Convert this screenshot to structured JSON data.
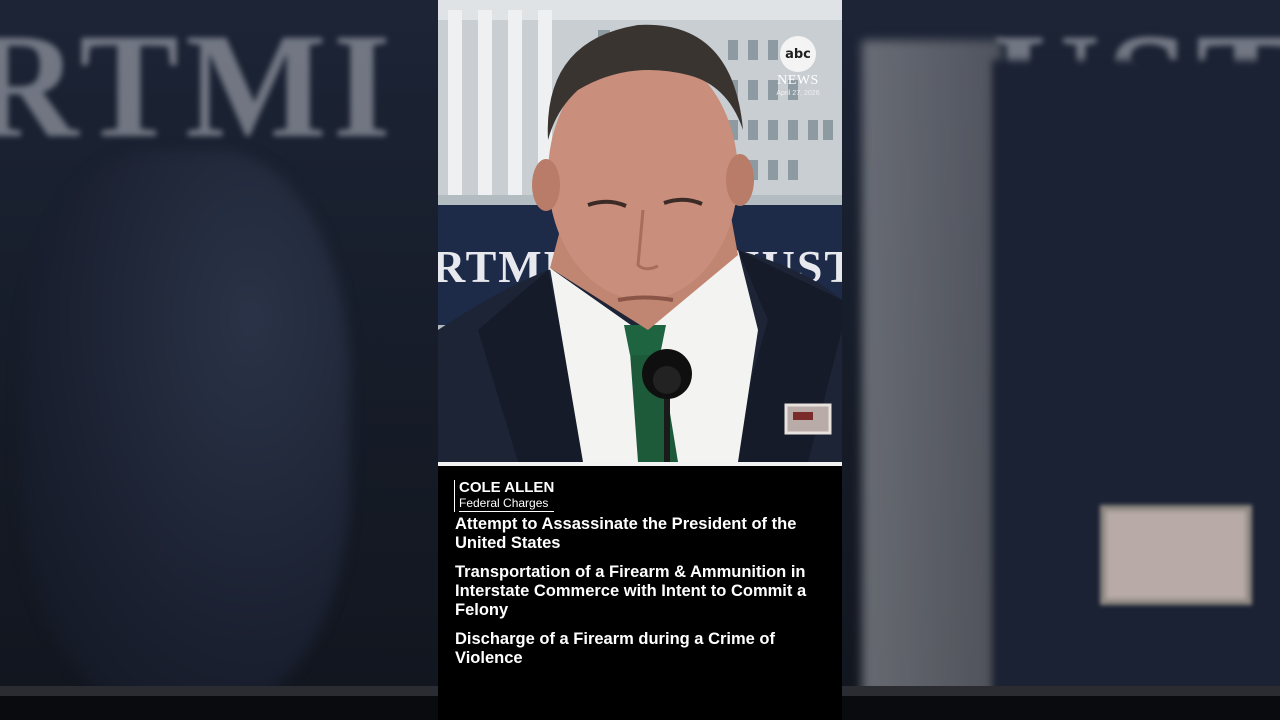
{
  "side_text": {
    "left": "RTMI",
    "right": "USTI"
  },
  "banner_text": "RTMENT OF JUST",
  "logo": {
    "network": "abc",
    "label": "NEWS",
    "date": "April 27, 2026"
  },
  "lower_third": {
    "name": "COLE ALLEN",
    "subtitle": "Federal Charges"
  },
  "charges": [
    "Attempt to Assassinate the President of the United States",
    "Transportation of a Firearm & Ammunition in Interstate Commerce with Intent to Commit a Felony",
    "Discharge of a Firearm during a Crime of Violence"
  ]
}
